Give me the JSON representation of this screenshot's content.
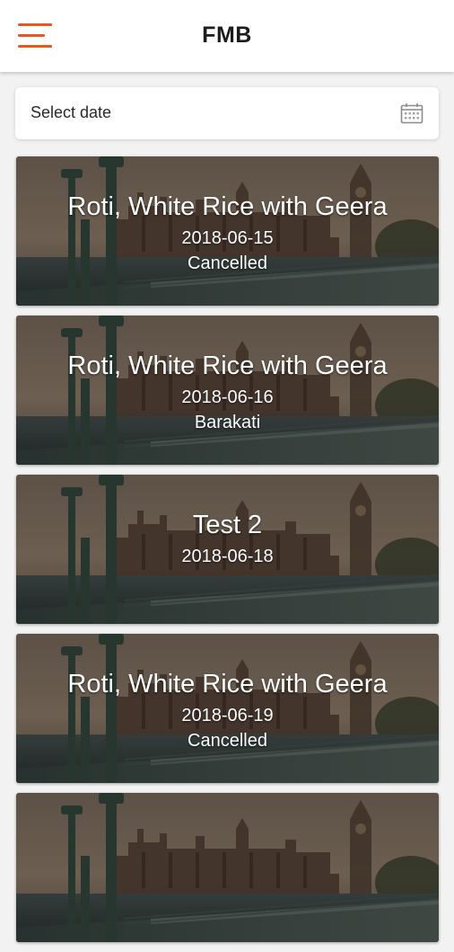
{
  "app": {
    "title": "FMB"
  },
  "colors": {
    "accent": "#e8571c"
  },
  "date_picker": {
    "placeholder": "Select date",
    "icon": "calendar-icon"
  },
  "meals": [
    {
      "name": "Roti, White Rice with Geera",
      "date": "2018-06-15",
      "status": "Cancelled"
    },
    {
      "name": "Roti, White Rice with Geera",
      "date": "2018-06-16",
      "status": "Barakati"
    },
    {
      "name": "Test 2",
      "date": "2018-06-18",
      "status": ""
    },
    {
      "name": "Roti, White Rice with Geera",
      "date": "2018-06-19",
      "status": "Cancelled"
    }
  ]
}
